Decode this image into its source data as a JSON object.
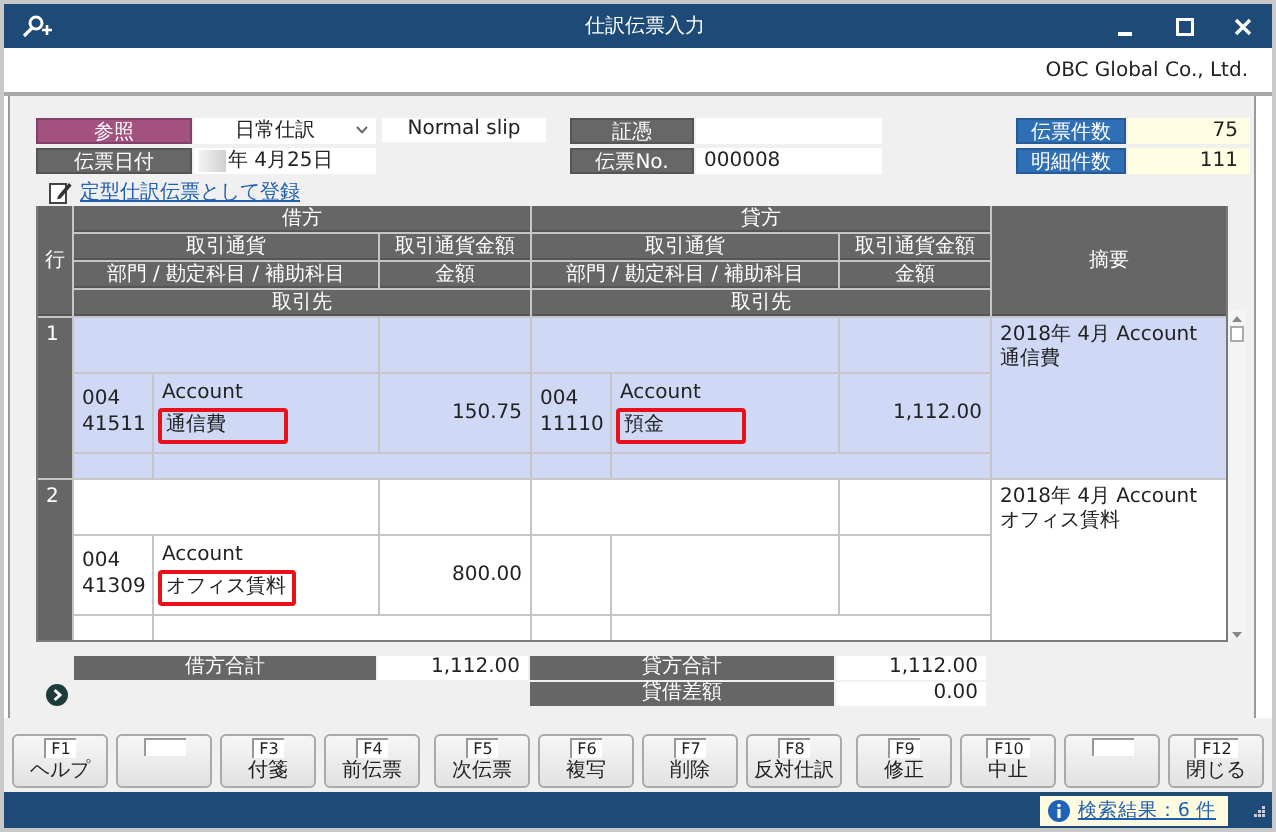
{
  "window": {
    "title": "仕訳伝票入力",
    "company": "OBC Global Co., Ltd."
  },
  "header": {
    "reference_label": "参照",
    "slip_type": "日常仕訳",
    "slip_type_note": "Normal slip",
    "date_label": "伝票日付",
    "date_value": "年  4月25日",
    "voucher_label": "証憑",
    "slip_no_label": "伝票No.",
    "slip_no": "000008"
  },
  "counts": [
    {
      "label": "伝票件数",
      "value": "75"
    },
    {
      "label": "明細件数",
      "value": "111"
    }
  ],
  "template_link": "定型仕訳伝票として登録",
  "grid": {
    "row_header": "行",
    "summary_header": "摘要",
    "sides": [
      {
        "title": "借方",
        "currency": "取引通貨",
        "currency_amount": "取引通貨金額",
        "account": "部門 / 勘定科目 / 補助科目",
        "amount": "金額",
        "partner": "取引先"
      },
      {
        "title": "貸方",
        "currency": "取引通貨",
        "currency_amount": "取引通貨金額",
        "account": "部門 / 勘定科目 / 補助科目",
        "amount": "金額",
        "partner": "取引先"
      }
    ],
    "rows": [
      {
        "number": "1",
        "selected": true,
        "debit": {
          "department": "004",
          "account_code": "41511",
          "account_label": "Account",
          "account_name": "通信費",
          "highlighted": true,
          "amount": "150.75"
        },
        "credit": {
          "department": "004",
          "account_code": "11110",
          "account_label": "Account",
          "account_name": "預金",
          "highlighted": true,
          "amount": "1,112.00"
        },
        "summary": "2018年 4月 Account 通信費"
      },
      {
        "number": "2",
        "selected": false,
        "debit": {
          "department": "004",
          "account_code": "41309",
          "account_label": "Account",
          "account_name": "オフィス賃料",
          "highlighted": true,
          "amount": "800.00"
        },
        "summary": "2018年 4月 Account オフィス賃料"
      }
    ]
  },
  "totals": {
    "debit": {
      "label": "借方合計",
      "value": "1,112.00"
    },
    "credit": {
      "label": "貸方合計",
      "value": "1,112.00"
    },
    "difference": {
      "label": "貸借差額",
      "value": "0.00"
    }
  },
  "function_keys": [
    {
      "kind": "key",
      "key": "F1",
      "label": "ヘルプ"
    },
    {
      "kind": "empty"
    },
    {
      "kind": "key",
      "key": "F3",
      "label": "付箋"
    },
    {
      "kind": "key",
      "key": "F4",
      "label": "前伝票"
    },
    {
      "kind": "key",
      "key": "F5",
      "label": "次伝票"
    },
    {
      "kind": "key",
      "key": "F6",
      "label": "複写"
    },
    {
      "kind": "key",
      "key": "F7",
      "label": "削除"
    },
    {
      "kind": "key",
      "key": "F8",
      "label": "反対仕訳"
    },
    {
      "kind": "key",
      "key": "F9",
      "label": "修正"
    },
    {
      "kind": "key",
      "key": "F10",
      "label": "中止"
    },
    {
      "kind": "empty"
    },
    {
      "kind": "key",
      "key": "F12",
      "label": "閉じる"
    }
  ],
  "status_bar": {
    "search_result": "検索結果：6 件"
  }
}
